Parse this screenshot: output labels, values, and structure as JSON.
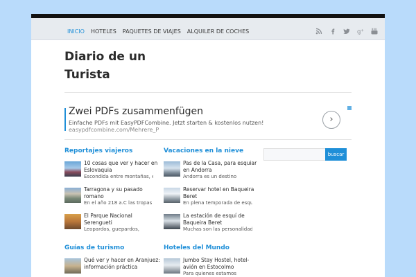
{
  "nav": {
    "items": [
      {
        "label": "INICIO"
      },
      {
        "label": "HOTELES"
      },
      {
        "label": "PAQUETES DE VIAJES"
      },
      {
        "label": "ALQUILER DE COCHES"
      }
    ],
    "social": [
      "rss-icon",
      "facebook-icon",
      "twitter-icon",
      "googleplus-icon",
      "youtube-icon"
    ]
  },
  "site": {
    "title_line1": "Diario de un",
    "title_line2": "Turista"
  },
  "ad": {
    "title": "Zwei PDFs zusammenfügen",
    "description": "Einfache PDFs mit EasyPDFCombine. Jetzt starten & kostenlos nutzen!",
    "url": "easypdfcombine.com/Mehrere_PDF"
  },
  "sections": {
    "reportajes": {
      "title": "Reportajes viajeros",
      "articles": [
        {
          "title": "10 cosas que ver y hacer en Eslovaquia",
          "desc": "Escondida entre montañas, en"
        },
        {
          "title": "Tarragona y su pasado romano",
          "desc": "En el año 218 a.C las tropas"
        },
        {
          "title": "El Parque Nacional Serengueti",
          "desc": "Leopardos, guepardos,"
        }
      ]
    },
    "nieve": {
      "title": "Vacaciones en la nieve",
      "articles": [
        {
          "title": "Pas de la Casa, para esquiar en Andorra",
          "desc": "Andorra es un destino"
        },
        {
          "title": "Reservar hotel en Baqueira Beret",
          "desc": "En plena temporada de esquí en"
        },
        {
          "title": "La estación de esquí de Baqueira Beret",
          "desc": "Muchas son las personalidades"
        }
      ]
    },
    "guias": {
      "title": "Guías de turismo",
      "articles": [
        {
          "title": "Qué ver y hacer en Aranjuez: información práctica",
          "desc": ""
        }
      ]
    },
    "hoteles": {
      "title": "Hoteles del Mundo",
      "articles": [
        {
          "title": "Jumbo Stay Hostel, hotel-avión en Estocolmo",
          "desc": "Para quienes estamos"
        }
      ]
    }
  },
  "search": {
    "button": "buscar",
    "placeholder": ""
  }
}
